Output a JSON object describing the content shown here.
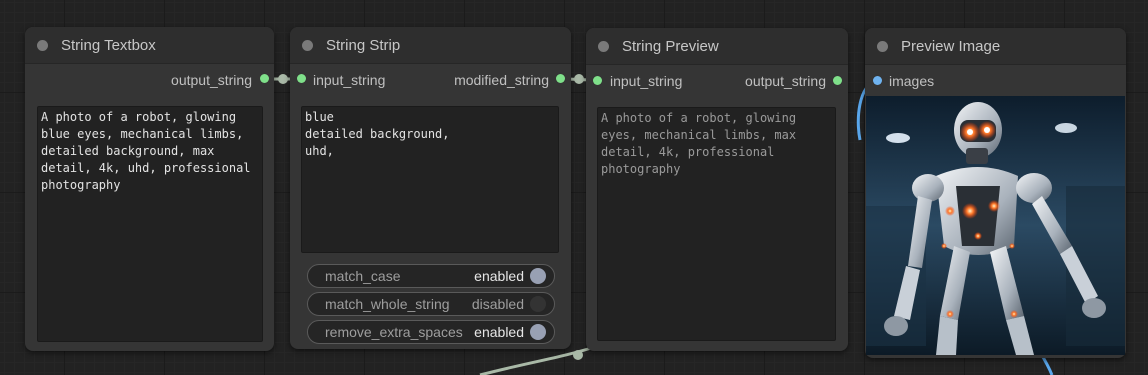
{
  "nodes": {
    "string_textbox": {
      "title": "String Textbox",
      "output": "output_string",
      "text": "A photo of a robot, glowing\nblue eyes, mechanical limbs,\ndetailed background, max\ndetail, 4k, uhd, professional\nphotography"
    },
    "string_strip": {
      "title": "String Strip",
      "input": "input_string",
      "output": "modified_string",
      "text": "blue\ndetailed background,\nuhd,",
      "toggles": [
        {
          "label": "match_case",
          "state": "enabled",
          "on": true
        },
        {
          "label": "match_whole_string",
          "state": "disabled",
          "on": false
        },
        {
          "label": "remove_extra_spaces",
          "state": "enabled",
          "on": true
        }
      ]
    },
    "string_preview": {
      "title": "String Preview",
      "input": "input_string",
      "output": "output_string",
      "text": "A photo of a robot, glowing\neyes, mechanical limbs, max\ndetail, 4k, professional\nphotography"
    },
    "preview_image": {
      "title": "Preview Image",
      "input": "images",
      "image_subject": "humanoid robot with glowing red eyes"
    }
  },
  "colors": {
    "string_slot": "#7fe08a",
    "image_slot": "#6fb3f0",
    "string_wire": "#a9b9a7",
    "image_wire": "#5aa7ec"
  }
}
